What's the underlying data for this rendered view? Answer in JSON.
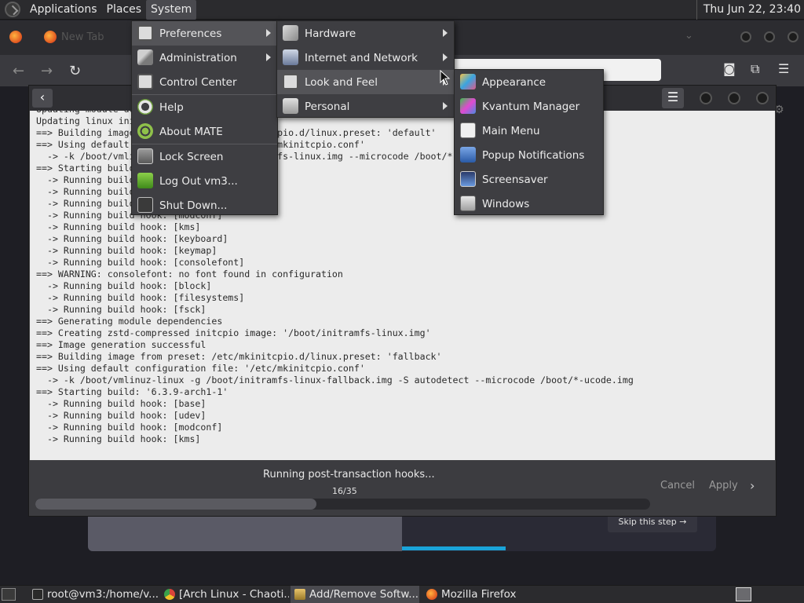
{
  "top_panel": {
    "applications": "Applications",
    "places": "Places",
    "system": "System",
    "clock": "Thu Jun 22, 23:40"
  },
  "firefox": {
    "tab_title": "New Tab"
  },
  "system_menu": {
    "items": [
      {
        "label": "Preferences",
        "icon": "gear-icon"
      },
      {
        "label": "Administration",
        "icon": "tools-icon"
      },
      {
        "label": "Control Center",
        "icon": "gear-icon"
      },
      {
        "label": "Help",
        "icon": "help-icon"
      },
      {
        "label": "About MATE",
        "icon": "mate-icon"
      },
      {
        "label": "Lock Screen",
        "icon": "lock-icon"
      },
      {
        "label": "Log Out vm3...",
        "icon": "logout-icon"
      },
      {
        "label": "Shut Down...",
        "icon": "power-icon"
      }
    ]
  },
  "preferences_menu": {
    "items": [
      {
        "label": "Hardware",
        "icon": "hardware-icon"
      },
      {
        "label": "Internet and Network",
        "icon": "network-icon"
      },
      {
        "label": "Look and Feel",
        "icon": "gear-icon"
      },
      {
        "label": "Personal",
        "icon": "personal-icon"
      }
    ]
  },
  "look_and_feel_menu": {
    "items": [
      {
        "label": "Appearance",
        "icon": "appearance-icon"
      },
      {
        "label": "Kvantum Manager",
        "icon": "kvantum-icon"
      },
      {
        "label": "Main Menu",
        "icon": "main-menu-icon"
      },
      {
        "label": "Popup Notifications",
        "icon": "notification-icon"
      },
      {
        "label": "Screensaver",
        "icon": "screensaver-icon"
      },
      {
        "label": "Windows",
        "icon": "windows-icon"
      }
    ]
  },
  "pamac": {
    "terminal_text": "Updating module dependencies...\nUpdating linux initcpios...\n==> Building image from preset: /etc/mkinitcpio.d/linux.preset: 'default'\n==> Using default configuration file: '/etc/mkinitcpio.conf'\n  -> -k /boot/vmlinuz-linux -g /boot/initramfs-linux.img --microcode /boot/*-ucode.img\n==> Starting build: '6.3.9-arch1-1'\n  -> Running build hook: [base]\n  -> Running build hook: [udev]\n  -> Running build hook: [autodetect]\n  -> Running build hook: [modconf]\n  -> Running build hook: [kms]\n  -> Running build hook: [keyboard]\n  -> Running build hook: [keymap]\n  -> Running build hook: [consolefont]\n==> WARNING: consolefont: no font found in configuration\n  -> Running build hook: [block]\n  -> Running build hook: [filesystems]\n  -> Running build hook: [fsck]\n==> Generating module dependencies\n==> Creating zstd-compressed initcpio image: '/boot/initramfs-linux.img'\n==> Image generation successful\n==> Building image from preset: /etc/mkinitcpio.d/linux.preset: 'fallback'\n==> Using default configuration file: '/etc/mkinitcpio.conf'\n  -> -k /boot/vmlinuz-linux -g /boot/initramfs-linux-fallback.img -S autodetect --microcode /boot/*-ucode.img\n==> Starting build: '6.3.9-arch1-1'\n  -> Running build hook: [base]\n  -> Running build hook: [udev]\n  -> Running build hook: [modconf]\n  -> Running build hook: [kms]",
    "status": "Running post-transaction hooks...",
    "progress_label": "16/35",
    "progress_fraction": 0.457,
    "cancel": "Cancel",
    "apply": "Apply"
  },
  "background_page": {
    "skip_step": "Skip this step →"
  },
  "taskbar": {
    "tasks": [
      {
        "label": "root@vm3:/home/v...",
        "icon": "terminal-icon"
      },
      {
        "label": "[Arch Linux - Chaoti...",
        "icon": "chromium-icon"
      },
      {
        "label": "Add/Remove Softw...",
        "icon": "package-icon"
      },
      {
        "label": "Mozilla Firefox",
        "icon": "firefox-icon"
      }
    ]
  }
}
